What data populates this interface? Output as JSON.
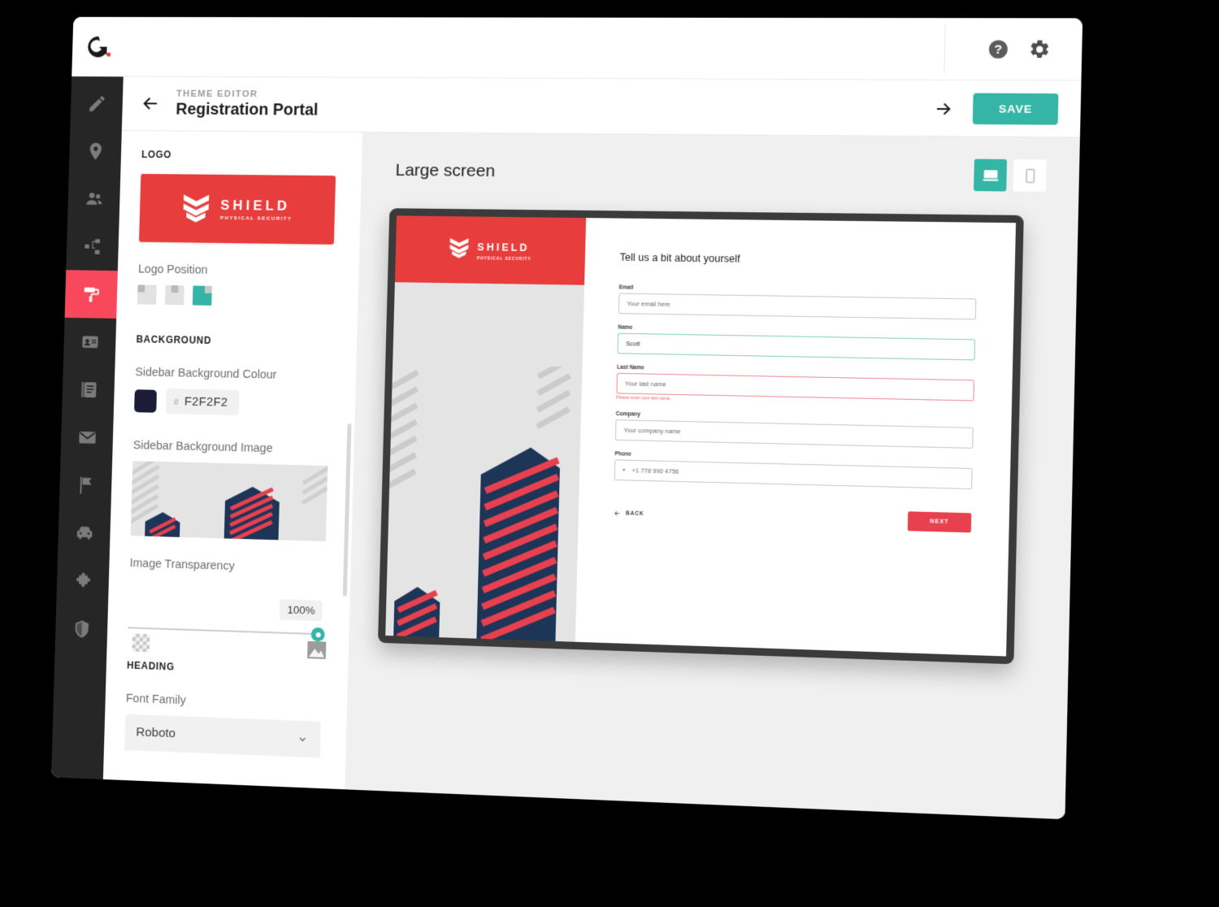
{
  "brand": {
    "logo_alt": "G.",
    "help_icon": "help-icon",
    "settings_icon": "gear-icon"
  },
  "rail": {
    "items": [
      {
        "icon": "pencil-icon",
        "name": "edit"
      },
      {
        "icon": "location-pin-icon",
        "name": "locations"
      },
      {
        "icon": "people-icon",
        "name": "people"
      },
      {
        "icon": "org-chart-icon",
        "name": "structure"
      },
      {
        "icon": "paint-roller-icon",
        "name": "theme-editor",
        "active": true
      },
      {
        "icon": "id-badge-icon",
        "name": "badges"
      },
      {
        "icon": "document-icon",
        "name": "documents"
      },
      {
        "icon": "mail-icon",
        "name": "mail"
      },
      {
        "icon": "flag-icon",
        "name": "flags"
      },
      {
        "icon": "car-icon",
        "name": "vehicles"
      },
      {
        "icon": "puzzle-icon",
        "name": "integrations"
      },
      {
        "icon": "shield-icon",
        "name": "security"
      }
    ]
  },
  "header": {
    "kicker": "THEME EDITOR",
    "title": "Registration Portal",
    "back_icon": "arrow-left-icon",
    "forward_icon": "arrow-right-icon",
    "save_label": "SAVE"
  },
  "panel": {
    "logo_section": "LOGO",
    "logo": {
      "name": "SHIELD",
      "tagline": "PHYSICAL SECURITY"
    },
    "logo_position_label": "Logo Position",
    "logo_position_options": [
      "left",
      "center",
      "right"
    ],
    "logo_position_selected": "right",
    "background_section": "BACKGROUND",
    "sidebar_colour_label": "Sidebar Background Colour",
    "sidebar_colour_hash": "#",
    "sidebar_colour_value": "F2F2F2",
    "sidebar_colour_swatch": "#1D1C38",
    "sidebar_image_label": "Sidebar Background Image",
    "transparency_label": "Image Transparency",
    "transparency_value": "100%",
    "transparency_min_icon": "checkerboard-icon",
    "transparency_max_icon": "image-icon",
    "heading_section": "HEADING",
    "font_family_label": "Font Family",
    "font_family_value": "Roboto"
  },
  "preview": {
    "screen_label": "Large screen",
    "device_desktop_icon": "desktop-icon",
    "device_mobile_icon": "mobile-icon",
    "device_selected": "desktop",
    "logo": {
      "name": "SHIELD",
      "tagline": "PHYSICAL SECURITY"
    },
    "form": {
      "heading": "Tell us a bit about yourself",
      "fields": [
        {
          "label": "Email",
          "value": "Your email here",
          "state": "placeholder"
        },
        {
          "label": "Name",
          "value": "Scott",
          "state": "focused"
        },
        {
          "label": "Last Name",
          "value": "Your last name",
          "state": "error",
          "error": "Please enter your last name"
        },
        {
          "label": "Company",
          "value": "Your company name",
          "state": "placeholder"
        },
        {
          "label": "Phone",
          "value": "+1 778 990 4756",
          "state": "filled",
          "prefix_icon": "chevron-down-icon"
        }
      ],
      "back_label": "BACK",
      "next_label": "NEXT"
    }
  },
  "colors": {
    "accent_teal": "#35B5A6",
    "brand_red": "#E83D3D",
    "rail_dark": "#262626",
    "navy": "#1D3557"
  }
}
